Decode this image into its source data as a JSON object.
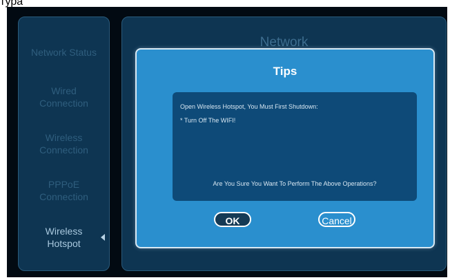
{
  "caption": "тура",
  "sidebar": {
    "items": [
      {
        "label_lines": [
          "Network Status"
        ],
        "active": false
      },
      {
        "label_lines": [
          "Wired",
          "Connection"
        ],
        "active": false
      },
      {
        "label_lines": [
          "Wireless",
          "Connection"
        ],
        "active": false
      },
      {
        "label_lines": [
          "PPPoE",
          "Connection"
        ],
        "active": false
      },
      {
        "label_lines": [
          "Wireless",
          "Hotspot"
        ],
        "active": true
      }
    ]
  },
  "main": {
    "title": "Network"
  },
  "dialog": {
    "title": "Tips",
    "message_line1": "Open Wireless Hotspot, You Must First Shutdown:",
    "message_line2": "* Turn Off The WIFI!",
    "confirm_text": "Are You Sure You Want To Perform The Above Operations?",
    "ok_label": "OK",
    "cancel_label": "Cancel"
  },
  "colors": {
    "panel_bg": "#0e3552",
    "dialog_bg": "#2a8fce",
    "message_bg": "#0e4a78"
  }
}
